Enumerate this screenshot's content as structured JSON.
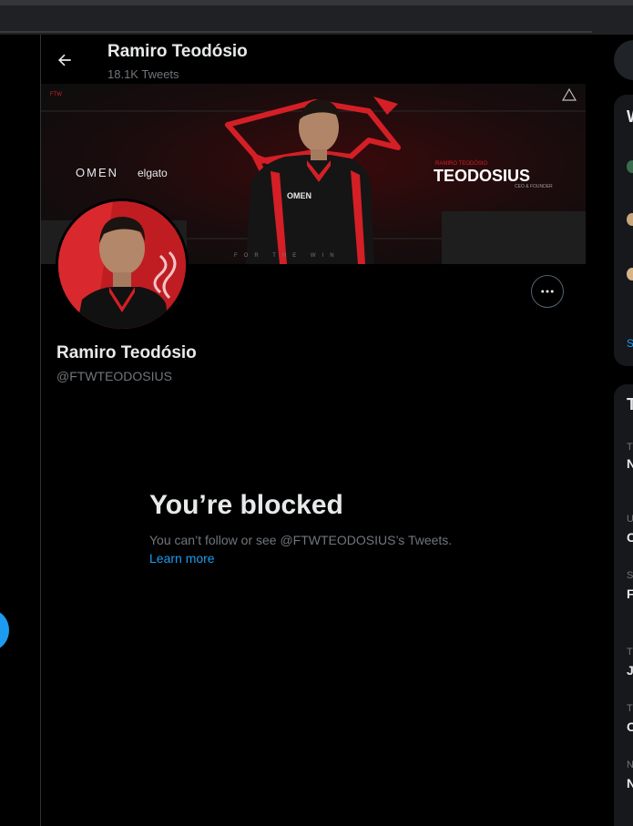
{
  "header": {
    "title": "Ramiro Teodósio",
    "tweet_count": "18.1K Tweets"
  },
  "banner": {
    "brand_tag": "FTW",
    "sponsors": [
      "OMEN",
      "elgato"
    ],
    "small_title": "RAMIRO TEODÓSIO",
    "big_title": "TEODOSIUS",
    "role": "CEO & FOUNDER",
    "shirt_text": "OMEN",
    "tagline": "FOR THE WIN"
  },
  "profile": {
    "name": "Ramiro Teodósio",
    "handle": "@FTWTEODOSIUS"
  },
  "blocked": {
    "title": "You’re blocked",
    "text": "You can’t follow or see @FTWTEODOSIUS’s Tweets.",
    "link": "Learn more"
  },
  "right_column": {
    "card1_heading": "W",
    "card1_link": "S",
    "card2_heading": "T",
    "trends": [
      {
        "meta": "T",
        "name": "N"
      },
      {
        "meta": "U",
        "name": "C"
      },
      {
        "meta": "S",
        "name": "F"
      },
      {
        "meta": "T",
        "name": "J"
      },
      {
        "meta": "T",
        "name": "C"
      },
      {
        "meta": "N",
        "name": "N"
      }
    ]
  },
  "colors": {
    "accent": "#1d9bf0",
    "banner_red": "#d41f26",
    "muted_text": "#71767b"
  }
}
